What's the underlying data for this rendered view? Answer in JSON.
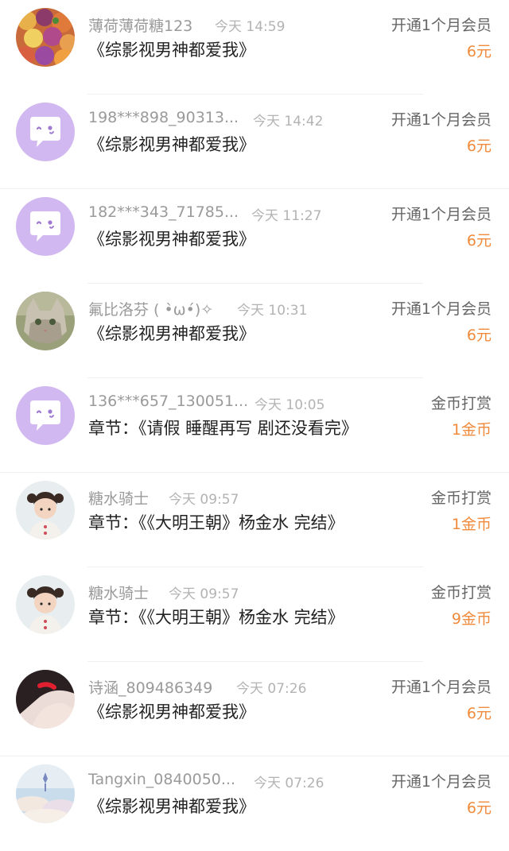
{
  "records": [
    {
      "name": "薄荷薄荷糖123",
      "time": "今天 14:59",
      "title": "《综影视男神都爱我》",
      "type": "开通1个月会员",
      "amount": "6元",
      "avatar": "fruit-photo-avatar"
    },
    {
      "name": "198***898_90313...",
      "time": "今天 14:42",
      "title": "《综影视男神都爱我》",
      "type": "开通1个月会员",
      "amount": "6元",
      "avatar": "default-chat-avatar"
    },
    {
      "name": "182***343_71785...",
      "time": "今天 11:27",
      "title": "《综影视男神都爱我》",
      "type": "开通1个月会员",
      "amount": "6元",
      "avatar": "default-chat-avatar"
    },
    {
      "name": "氟比洛芬 ( •̀ω•́)✧",
      "time": "今天 10:31",
      "title": "《综影视男神都爱我》",
      "type": "开通1个月会员",
      "amount": "6元",
      "avatar": "cat-photo-avatar"
    },
    {
      "name": "136***657_130051...",
      "time": "今天 10:05",
      "title": "章节：《请假 睡醒再写 剧还没看完》",
      "type": "金币打赏",
      "amount": "1金币",
      "avatar": "default-chat-avatar"
    },
    {
      "name": "糖水骑士",
      "time": "今天 09:57",
      "title": "章节：《《大明王朝》杨金水 完结》",
      "type": "金币打赏",
      "amount": "1金币",
      "avatar": "child-photo-avatar"
    },
    {
      "name": "糖水骑士",
      "time": "今天 09:57",
      "title": "章节：《《大明王朝》杨金水 完结》",
      "type": "金币打赏",
      "amount": "9金币",
      "avatar": "child-photo-avatar"
    },
    {
      "name": "诗涵_809486349",
      "time": "今天 07:26",
      "title": "《综影视男神都爱我》",
      "type": "开通1个月会员",
      "amount": "6元",
      "avatar": "portrait-photo-avatar"
    },
    {
      "name": "Tangxin_0840050...",
      "time": "今天 07:26",
      "title": "《综影视男神都爱我》",
      "type": "开通1个月会员",
      "amount": "6元",
      "avatar": "sky-photo-avatar"
    }
  ],
  "colors": {
    "accent_amount": "#f08a3c",
    "default_avatar_bg": "#d2b8f0"
  }
}
